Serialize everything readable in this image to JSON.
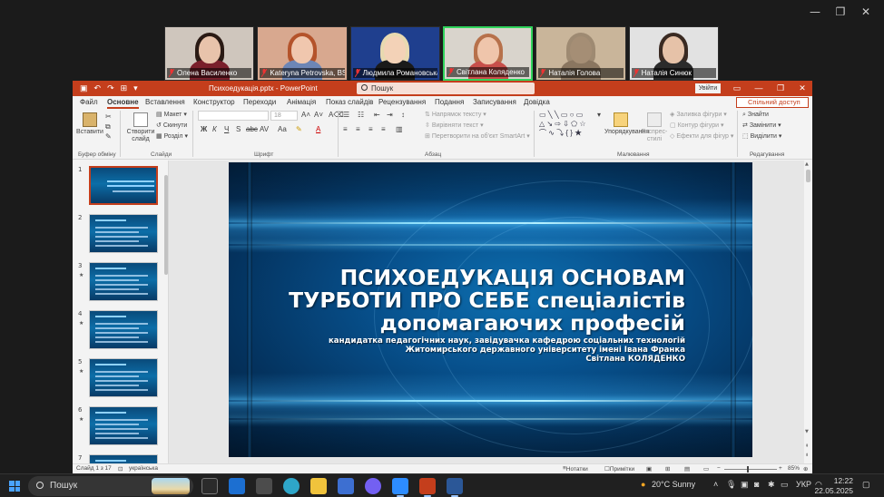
{
  "zoom": {
    "participants": [
      {
        "name": "Олена Василенко",
        "active": false,
        "bg": "#cfc6bd",
        "hair": "#2a1a14",
        "face": "#e8c3ab",
        "body": "#7a1f2b"
      },
      {
        "name": "Kateryna Petrovska, BS...",
        "active": false,
        "bg": "#d8a88f",
        "hair": "#b4532b",
        "face": "#f0c7ae",
        "body": "#6d86b6"
      },
      {
        "name": "Людмила Романовська",
        "active": false,
        "bg": "#1f3f8e",
        "hair": "#e8d9b0",
        "face": "#f3d2b7",
        "body": "#1a1a1a"
      },
      {
        "name": "Світлана Коляденко",
        "active": true,
        "bg": "#d9d4cc",
        "hair": "#b7714b",
        "face": "#efc5ab",
        "body": "#c74f4a"
      },
      {
        "name": "Наталія Голова",
        "active": false,
        "bg": "#c9b59a",
        "hair": "#9e8a72",
        "face": "#a58e75",
        "body": "#8a7660"
      },
      {
        "name": "Наталія Синюк",
        "active": false,
        "bg": "#e2e2e2",
        "hair": "#3a2a22",
        "face": "#e6c2a8",
        "body": "#2b2b2b"
      }
    ]
  },
  "ppt": {
    "title": "Психоедукація.pptx  -  PowerPoint",
    "search_placeholder": "Пошук",
    "signin": "Увійти",
    "tabs": [
      "Файл",
      "Основне",
      "Вставлення",
      "Конструктор",
      "Переходи",
      "Анімація",
      "Показ слайдів",
      "Рецензування",
      "Подання",
      "Записування",
      "Довідка"
    ],
    "active_tab": "Основне",
    "share": "Спільний доступ",
    "ribbon": {
      "paste": "Вставити",
      "clipboard": "Буфер обміну",
      "new_slide": "Створити слайд",
      "layout": "Макет",
      "reset": "Скинути",
      "section": "Розділ",
      "slides": "Слайди",
      "font_size": "18",
      "font_group": "Шрифт",
      "text_direction": "Напрямок тексту",
      "align_text": "Вирівняти текст",
      "smartart": "Перетворити на об'єкт SmartArt",
      "paragraph": "Абзац",
      "arrange": "Упорядкування",
      "quick_styles": "Експрес-стилі",
      "shape_fill": "Заливка фігури",
      "shape_outline": "Контур фігури",
      "shape_effects": "Ефекти для фігур",
      "drawing": "Малювання",
      "find": "Знайти",
      "replace": "Замінити",
      "select": "Виділити",
      "editing": "Редагування"
    },
    "slide_numbers": [
      "1",
      "2",
      "3",
      "4",
      "5",
      "6",
      "7"
    ],
    "slide": {
      "title_lines": [
        "ПСИХОЕДУКАЦІЯ ОСНОВАМ",
        "ТУРБОТИ ПРО СЕБЕ спеціалістів",
        "допомагаючих професій"
      ],
      "sub_lines": [
        "кандидатка педагогічних наук, завідувачка кафедрою соціальних технологій",
        "Житомирського державного університету імені Івана Франка",
        "Світлана КОЛЯДЕНКО"
      ]
    },
    "status": {
      "slide_of": "Слайд 1 з 17",
      "language": "українська",
      "notes": "Нотатки",
      "comments": "Примітки",
      "zoom": "85%"
    }
  },
  "taskbar": {
    "search": "Пошук",
    "weather": "20°C  Sunny",
    "lang": "УКР",
    "time": "12:22",
    "date": "22.05.2025"
  }
}
